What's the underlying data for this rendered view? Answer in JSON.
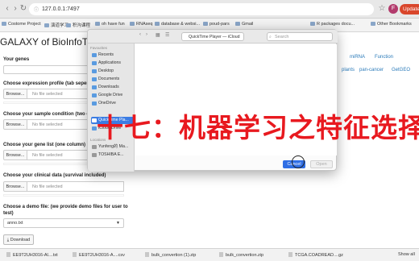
{
  "browser": {
    "url": "127.0.0.1:7497",
    "bookmarks": [
      "Costome Project",
      "演道学习",
      "积沟课程",
      "oh have fun",
      "RNAseq",
      "database & websi...",
      "poud-pars",
      "Gmail",
      "R packages docu...",
      "Other Bookmarks"
    ],
    "update_label": "Update",
    "avatar_letter": "F"
  },
  "page": {
    "title": "GALAXY of BioInfoTo",
    "fields": {
      "genes_label": "Your genes",
      "expression_label": "Choose expression profile (tab seperated",
      "sample_label": "Choose your sample condition (two co",
      "genelist_label": "Choose your gene list (one column)",
      "clinical_label": "Choose your clinical data (survival included)",
      "demo_label_line1": "Choose a demo file: (we provide demo files for user to",
      "demo_label_line2": "test)",
      "demo_selected": "anno.txt"
    },
    "browse_label": "Browse...",
    "no_file_label": "No file selected",
    "download_label": "Download",
    "right_links": [
      "miRNA",
      "Function",
      "plants",
      "pan-cancer",
      "GetGEO"
    ]
  },
  "dialog": {
    "location": "QuickTime Player — iCloud",
    "search_placeholder": "Search",
    "favourites_header": "Favourites",
    "favourites": [
      "Recents",
      "Applications",
      "Desktop",
      "Documents",
      "Downloads",
      "Google Drive",
      "OneDrive"
    ],
    "icloud": [
      "QuickTime Pla...",
      "iCloud Drive"
    ],
    "locations_header": "Locations",
    "locations": [
      "Yunfeng的 Ma...",
      "TOSHIBA E..."
    ],
    "cancel_label": "Cancel",
    "open_label": "Open"
  },
  "overlay_text": "十七：机器学习之特征选择",
  "downloads": [
    "EE9T2UH3016-Al....txt",
    "EE9T2UH3016-A....csv",
    "bulk_convertion (1).zip",
    "bulk_convertion.zip",
    "TCGA.COADREAD....gz"
  ],
  "show_all_label": "Show all",
  "colors": {
    "accent": "#2f6ee4",
    "overlay": "#e8191f",
    "link": "#2a7ab9"
  }
}
